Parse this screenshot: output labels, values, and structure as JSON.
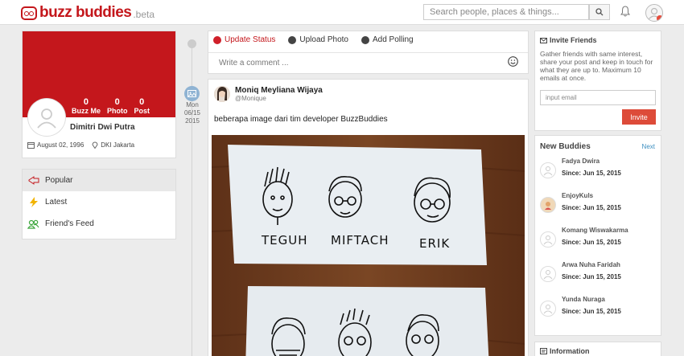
{
  "header": {
    "logo_text": "buzz buddies",
    "logo_beta": ".beta",
    "search_placeholder": "Search people, places & things..."
  },
  "profile": {
    "stats": [
      {
        "value": "0",
        "label": "Buzz Me"
      },
      {
        "value": "0",
        "label": "Photo"
      },
      {
        "value": "0",
        "label": "Post"
      }
    ],
    "name": "Dimitri Dwi Putra",
    "birthday": "August 02, 1996",
    "location": "DKI Jakarta",
    "cover_color": "#c4171c"
  },
  "menu": {
    "items": [
      {
        "label": "Popular",
        "icon": "popular-icon",
        "active": true
      },
      {
        "label": "Latest",
        "icon": "lightning-icon",
        "active": false
      },
      {
        "label": "Friend's Feed",
        "icon": "friends-icon",
        "active": false
      }
    ]
  },
  "composer": {
    "tabs": [
      {
        "label": "Update Status",
        "active": true
      },
      {
        "label": "Upload Photo",
        "active": false
      },
      {
        "label": "Add Polling",
        "active": false
      }
    ],
    "comment_placeholder": "Write a comment ..."
  },
  "timeline": {
    "day": "Mon",
    "date": "06/15",
    "year": "2015"
  },
  "post": {
    "author": "Moniq Meyliana Wijaya",
    "handle": "@Monique",
    "text": "beberapa image dari tim developer BuzzBuddies",
    "photo_names": [
      "TEGUH",
      "MIFTACH",
      "ERIK"
    ]
  },
  "invite": {
    "title": "Invite Friends",
    "description": "Gather friends with same interest, share your post and keep in touch for what they are up to. Maximum 10 emails at once.",
    "input_placeholder": "input email",
    "button_label": "Invite"
  },
  "buddies": {
    "title": "New Buddies",
    "next_label": "Next",
    "since_label": "Since:",
    "items": [
      {
        "name": "Fadya Dwira",
        "since": "Jun 15, 2015"
      },
      {
        "name": "EnjoyKuls",
        "since": "Jun 15, 2015"
      },
      {
        "name": "Komang Wiswakarma",
        "since": "Jun 15, 2015"
      },
      {
        "name": "Arwa Nuha Faridah",
        "since": "Jun 15, 2015"
      },
      {
        "name": "Yunda Nuraga",
        "since": "Jun 15, 2015"
      }
    ]
  },
  "information": {
    "title": "Information"
  },
  "colors": {
    "brand": "#c4171c",
    "invite_button": "#dd4b39",
    "link": "#3d8fc1"
  }
}
